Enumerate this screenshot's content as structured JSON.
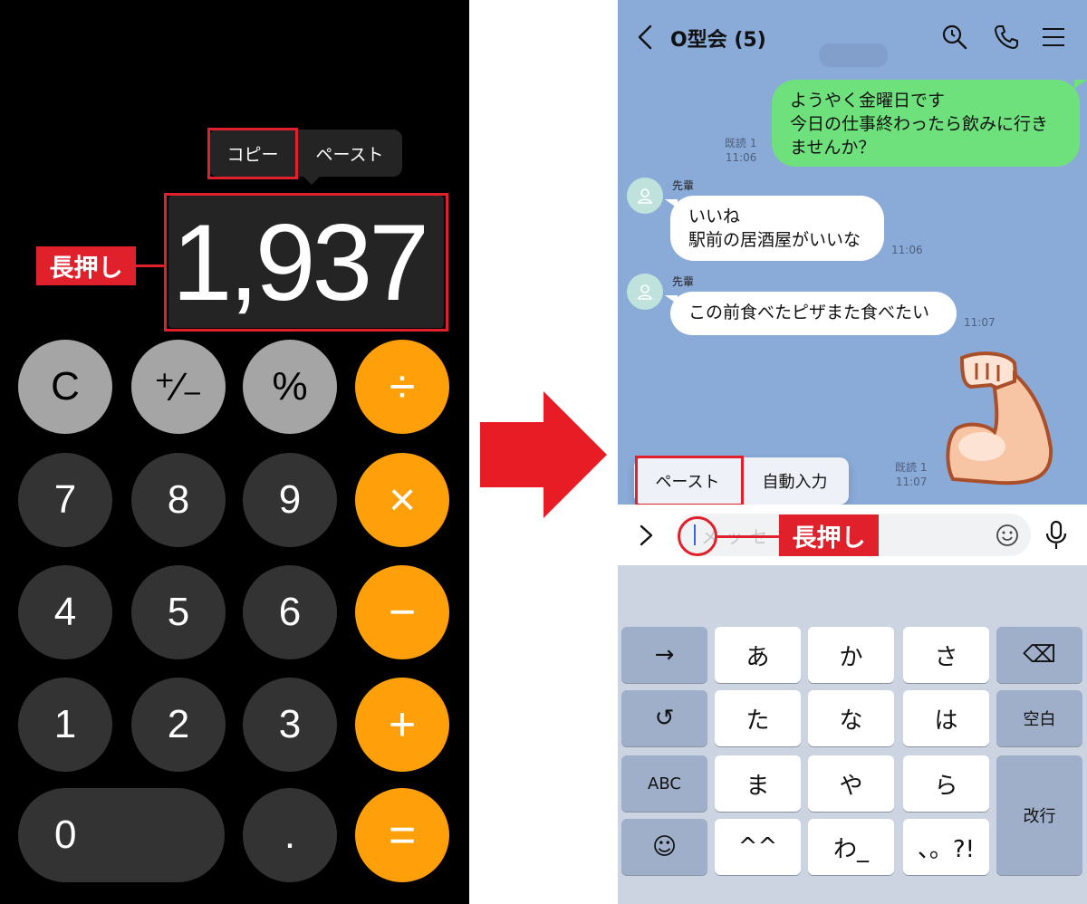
{
  "calculator": {
    "context_menu": {
      "copy_label": "コピー",
      "paste_label": "ペースト"
    },
    "display_value": "1,937",
    "annotation": "長押し",
    "keys": [
      {
        "label": "C",
        "type": "fn"
      },
      {
        "label": "⁺∕₋",
        "type": "fn"
      },
      {
        "label": "%",
        "type": "fn"
      },
      {
        "label": "÷",
        "type": "op"
      },
      {
        "label": "7",
        "type": "num"
      },
      {
        "label": "8",
        "type": "num"
      },
      {
        "label": "9",
        "type": "num"
      },
      {
        "label": "×",
        "type": "op"
      },
      {
        "label": "4",
        "type": "num"
      },
      {
        "label": "5",
        "type": "num"
      },
      {
        "label": "6",
        "type": "num"
      },
      {
        "label": "−",
        "type": "op"
      },
      {
        "label": "1",
        "type": "num"
      },
      {
        "label": "2",
        "type": "num"
      },
      {
        "label": "3",
        "type": "num"
      },
      {
        "label": "+",
        "type": "op"
      },
      {
        "label": "0",
        "type": "num"
      },
      {
        "label": ".",
        "type": "num"
      },
      {
        "label": "=",
        "type": "op"
      }
    ],
    "colors": {
      "function_key": "#a5a5a5",
      "number_key": "#333333",
      "operator_key": "#ff9f0a",
      "highlight": "#e0202a"
    }
  },
  "arrow": {
    "direction": "right",
    "color": "#e81c24"
  },
  "line_chat": {
    "header": {
      "title": "O型会 (5)",
      "icons": [
        "back-icon",
        "search-history-icon",
        "phone-icon",
        "menu-icon"
      ]
    },
    "messages": [
      {
        "from": "me",
        "lines": [
          "ようやく金曜日です",
          "今日の仕事終わったら飲みに行き",
          "ませんか？"
        ],
        "read": "既読 1",
        "time": "11:06"
      },
      {
        "from": "them",
        "sender": "先輩",
        "lines": [
          "いいね",
          "駅前の居酒屋がいいな"
        ],
        "time": "11:06"
      },
      {
        "from": "them",
        "sender": "先輩",
        "lines": [
          "この前食べたピザまた食べたい"
        ],
        "time": "11:07"
      },
      {
        "from": "me",
        "type": "sticker",
        "sticker": "flexed-biceps",
        "read": "既読 1",
        "time": "11:07"
      }
    ],
    "context_menu": {
      "paste_label": "ペースト",
      "autofill_label": "自動入力"
    },
    "input": {
      "placeholder": "メッセージ",
      "value": ""
    },
    "annotation": "長押し",
    "keyboard": {
      "rows": [
        [
          "→",
          "あ",
          "か",
          "さ",
          "⌫"
        ],
        [
          "↺",
          "た",
          "な",
          "は",
          "空白"
        ],
        [
          "ABC",
          "ま",
          "や",
          "ら",
          "改行"
        ],
        [
          "☺",
          "^^",
          "わ_",
          "、。?!"
        ]
      ]
    },
    "colors": {
      "background": "#8aaad8",
      "my_bubble": "#6fe17c",
      "their_bubble": "#ffffff",
      "highlight": "#e0202a"
    }
  }
}
